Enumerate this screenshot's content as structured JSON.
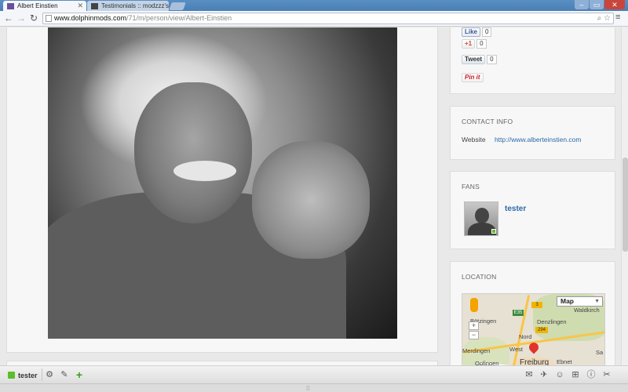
{
  "browser": {
    "tabs": [
      {
        "title": "Albert Einstien",
        "active": true
      },
      {
        "title": "Testimonials :: modzzz's p",
        "active": false
      }
    ],
    "url_host": "www.dolphinmods.com",
    "url_path": "/71/m/person/view/Albert-Einstien"
  },
  "social": {
    "like_label": "Like",
    "like_count": "0",
    "plus_label": "+1",
    "plus_count": "0",
    "tweet_label": "Tweet",
    "tweet_count": "0",
    "pin_label": "Pin it"
  },
  "contact": {
    "title": "CONTACT INFO",
    "website_label": "Website",
    "website_url": "http://www.alberteinstien.com"
  },
  "fans": {
    "title": "FANS",
    "items": [
      {
        "name": "tester"
      }
    ]
  },
  "location": {
    "title": "LOCATION",
    "map_type": "Map",
    "labels": {
      "denzlingen": "Denzlingen",
      "botzingen": "Bötzingen",
      "nord": "Nord",
      "west": "West",
      "merdingen": "Merdingen",
      "opfingen": "Opfingen",
      "freiburg": "Freiburg",
      "ebnet": "Ebnet",
      "waldkirch": "Waldkirch",
      "sa": "Sa",
      "route_3": "3",
      "route_294": "294",
      "route_e35": "E35"
    }
  },
  "bottom_bar": {
    "username": "tester"
  },
  "colors": {
    "link": "#2a6aa8",
    "online": "#5bbf2a",
    "marker": "#e0332d"
  }
}
